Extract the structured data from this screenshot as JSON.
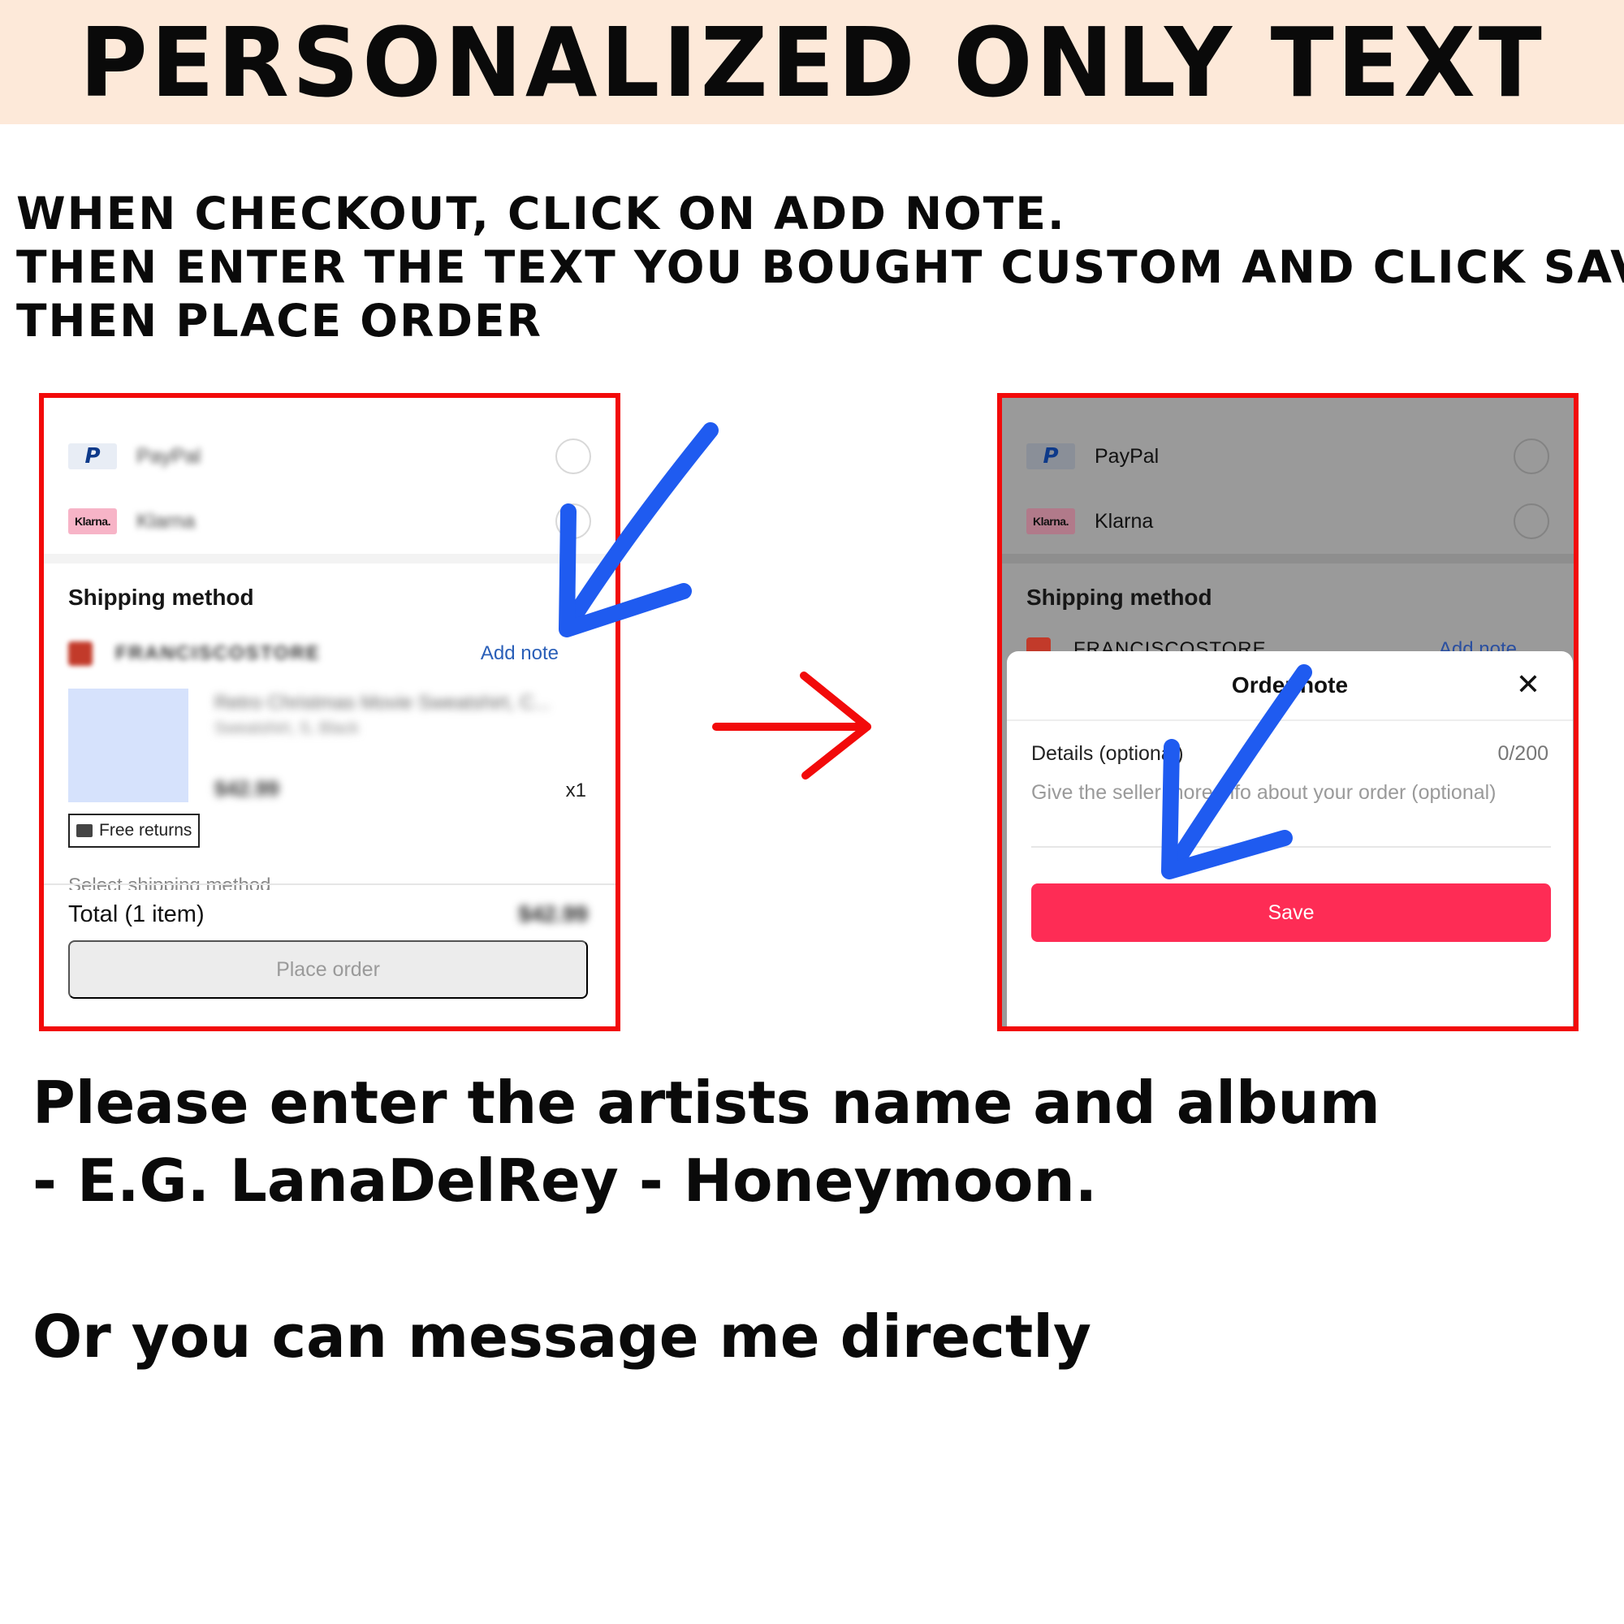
{
  "banner": {
    "title": "PERSONALIZED ONLY TEXT"
  },
  "instructions": {
    "lines": [
      "WHEN CHECKOUT, CLICK ON ADD NOTE.",
      "THEN ENTER THE TEXT YOU BOUGHT CUSTOM AND CLICK SAVE",
      "THEN PLACE ORDER"
    ]
  },
  "left_screen": {
    "payment_methods": [
      {
        "name": "PayPal",
        "logo": "P",
        "icon": "paypal-logo"
      },
      {
        "name": "Klarna",
        "logo": "Klarna.",
        "icon": "klarna-logo"
      }
    ],
    "shipping_title": "Shipping method",
    "store_name": "FRANCISCOSTORE",
    "add_note": "Add note",
    "product_title": "Retro Christmas Movie Sweatshirt, C...",
    "product_variant": "Sweatshirt, S, Black",
    "product_price": "$42.99",
    "quantity": "x1",
    "free_returns": "Free returns",
    "select_shipping": "Select shipping method",
    "total_label": "Total (1 item)",
    "total_value": "$42.99",
    "place_order": "Place order"
  },
  "right_screen": {
    "payment_methods": [
      {
        "name": "PayPal",
        "logo": "P",
        "icon": "paypal-logo"
      },
      {
        "name": "Klarna",
        "logo": "Klarna.",
        "icon": "klarna-logo"
      }
    ],
    "shipping_title": "Shipping method",
    "store_name": "FRANCISCOSTORE",
    "add_note": "Add note",
    "modal": {
      "title": "Order note",
      "close_glyph": "✕",
      "details_label": "Details (optional)",
      "details_count": "0/200",
      "details_placeholder": "Give the seller more info about your order (optional)",
      "save_label": "Save"
    }
  },
  "colors": {
    "frame_red": "#f20a0a",
    "arrow_blue": "#1f5bf0",
    "save_pink": "#fe2c55",
    "banner_bg": "#fde9d9"
  },
  "note": {
    "line1": "Please enter the artists name and album",
    "line2": "- E.G. LanaDelRey - Honeymoon.",
    "line3": "Or you can message me directly"
  }
}
